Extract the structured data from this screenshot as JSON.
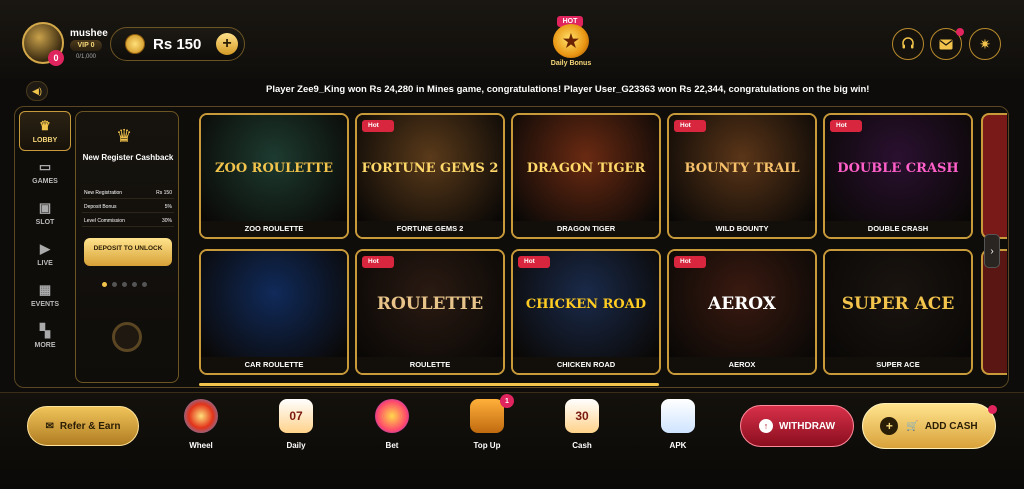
{
  "header": {
    "username": "mushee",
    "vip": "VIP 0",
    "vip_progress": "0/1,000",
    "avatar_badge": "0",
    "balance": "Rs 150",
    "balance_add": "+",
    "daily_bonus": {
      "badge": "HOT",
      "label": "Daily Bonus"
    },
    "icons": [
      "headset-icon",
      "mail-icon",
      "settings-icon"
    ]
  },
  "marquee": {
    "text": "Player Zee9_King won Rs 24,280 in Mines game, congratulations! Player User_G23363 won Rs 22,344, congratulations on the big win!"
  },
  "nav": {
    "items": [
      {
        "label": "LOBBY",
        "icon": "crown-icon",
        "active": true
      },
      {
        "label": "GAMES",
        "icon": "gamepad-icon"
      },
      {
        "label": "SLOT",
        "icon": "slot-icon"
      },
      {
        "label": "LIVE",
        "icon": "play-icon"
      },
      {
        "label": "EVENTS",
        "icon": "calendar-icon"
      },
      {
        "label": "MORE",
        "icon": "grid-icon"
      }
    ]
  },
  "promo": {
    "title": "New Register Cashback",
    "rows": [
      {
        "label": "New Registration",
        "value": "Rs 150"
      },
      {
        "label": "Deposit Bonus",
        "value": "5%"
      },
      {
        "label": "Level Commission",
        "value": "30%"
      }
    ],
    "button": "DEPOSIT TO UNLOCK"
  },
  "games": [
    {
      "title": "ZOO ROULETTE",
      "art_text": "ZOO ROULETTE",
      "hot": false,
      "bg": "#1d3b30",
      "fg": "#f2c44c"
    },
    {
      "title": "FORTUNE GEMS 2",
      "art_text": "FORTUNE GEMS 2",
      "hot": true,
      "bg": "#5a3a1a",
      "fg": "#ffd86a"
    },
    {
      "title": "DRAGON TIGER",
      "art_text": "DRAGON TIGER",
      "hot": false,
      "bg": "#6a2a12",
      "fg": "#ffd86a"
    },
    {
      "title": "WILD BOUNTY",
      "art_text": "BOUNTY TRAIL",
      "hot": true,
      "bg": "#5a3518",
      "fg": "#f6c16a"
    },
    {
      "title": "DOUBLE CRASH",
      "art_text": "DOUBLE CRASH",
      "hot": true,
      "bg": "#2a1030",
      "fg": "#ff5fc8"
    },
    {
      "title": "CAR ROULETTE",
      "art_text": "",
      "hot": false,
      "bg": "#102a5a",
      "fg": "#ffffff"
    },
    {
      "title": "ROULETTE",
      "art_text": "ROULETTE",
      "hot": true,
      "bg": "#2a1a12",
      "fg": "#e8c48a"
    },
    {
      "title": "CHICKEN ROAD",
      "art_text": "CHICKEN ROAD",
      "hot": true,
      "bg": "#1a2a4a",
      "fg": "#ffcc22"
    },
    {
      "title": "AEROX",
      "art_text": "AEROX",
      "hot": true,
      "bg": "#3a1a10",
      "fg": "#ffffff"
    },
    {
      "title": "SUPER ACE",
      "art_text": "SUPER ACE",
      "hot": false,
      "bg": "#1a1410",
      "fg": "#f2c44c"
    }
  ],
  "hot_label": "Hot",
  "bottom": {
    "refer": "Refer & Earn",
    "items": [
      {
        "label": "Wheel",
        "icon": "wheel-icon",
        "glyph": ""
      },
      {
        "label": "Daily",
        "icon": "calendar-icon",
        "glyph": "07"
      },
      {
        "label": "Bet",
        "icon": "bet-wheel-icon",
        "glyph": ""
      },
      {
        "label": "Top Up",
        "icon": "treasure-chest-icon",
        "glyph": ""
      },
      {
        "label": "Cash",
        "icon": "calendar-icon",
        "glyph": "30"
      },
      {
        "label": "APK",
        "icon": "download-icon",
        "glyph": ""
      }
    ],
    "topup_badge": "1",
    "withdraw": "WITHDRAW",
    "add_cash": "ADD CASH"
  },
  "colors": {
    "accent": "#f2c44c",
    "alert": "#e0245e",
    "withdraw": "#c0223a"
  }
}
